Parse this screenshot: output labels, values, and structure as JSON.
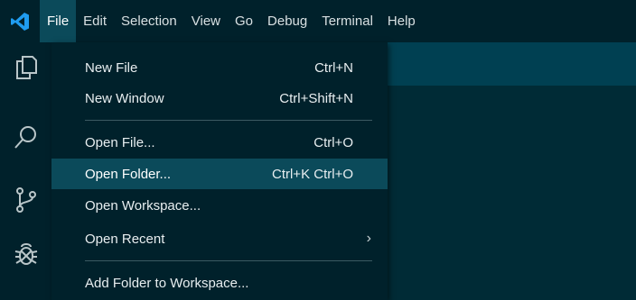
{
  "menubar": {
    "items": [
      {
        "label": "File",
        "active": true
      },
      {
        "label": "Edit"
      },
      {
        "label": "Selection"
      },
      {
        "label": "View"
      },
      {
        "label": "Go"
      },
      {
        "label": "Debug"
      },
      {
        "label": "Terminal"
      },
      {
        "label": "Help"
      }
    ]
  },
  "activitybar": {
    "icons": [
      "explorer-icon",
      "search-icon",
      "source-control-icon",
      "debug-icon"
    ]
  },
  "file_menu": {
    "items": [
      {
        "label": "New File",
        "shortcut": "Ctrl+N"
      },
      {
        "label": "New Window",
        "shortcut": "Ctrl+Shift+N"
      },
      {
        "label": "Open File...",
        "shortcut": "Ctrl+O"
      },
      {
        "label": "Open Folder...",
        "shortcut": "Ctrl+K Ctrl+O",
        "highlighted": true
      },
      {
        "label": "Open Workspace...",
        "shortcut": ""
      },
      {
        "label": "Open Recent",
        "shortcut": "",
        "submenu": true
      },
      {
        "label": "Add Folder to Workspace...",
        "shortcut": ""
      }
    ]
  },
  "colors": {
    "background": "#002b36",
    "menubar": "#00212b",
    "highlight": "#0b4a5a",
    "tabstrip": "#004052",
    "logo": "#1f9cf0"
  }
}
